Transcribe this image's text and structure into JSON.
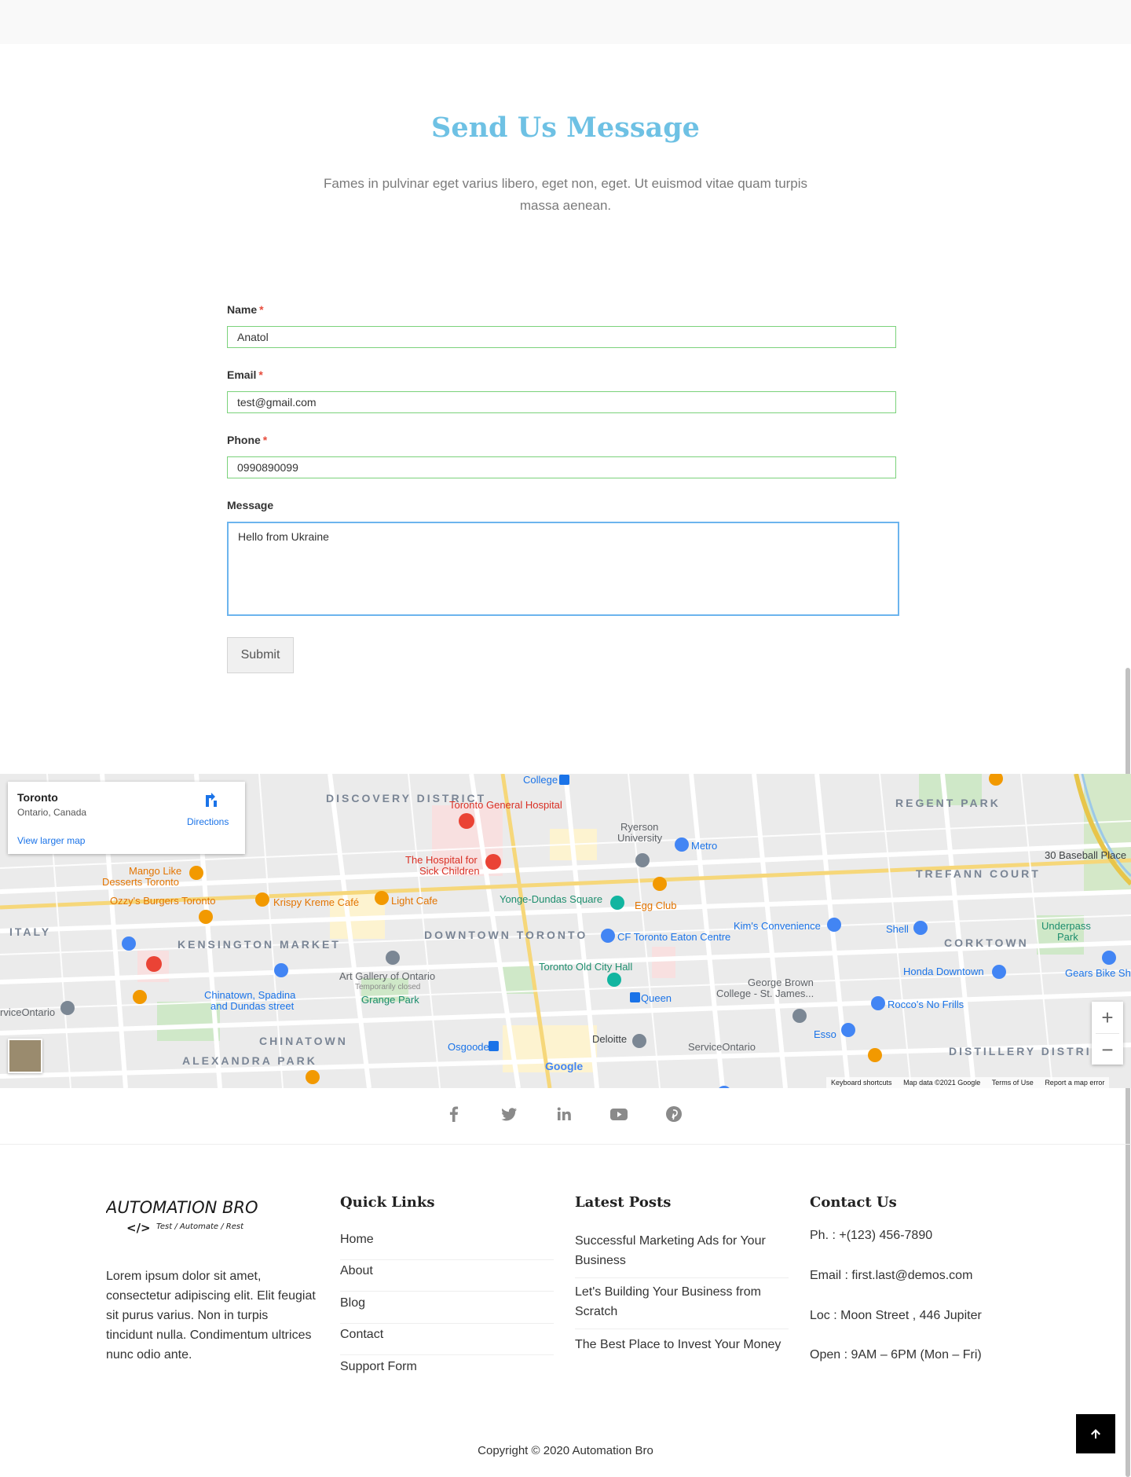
{
  "contact_section": {
    "title": "Send Us Message",
    "description": "Fames in pulvinar eget varius libero, eget non, eget. Ut euismod vitae quam turpis massa aenean."
  },
  "form": {
    "name_label": "Name",
    "email_label": "Email",
    "phone_label": "Phone",
    "message_label": "Message",
    "required_mark": "*",
    "name_value": "Anatol",
    "email_value": "test@gmail.com",
    "phone_value": "0990890099",
    "message_value": "Hello from Ukraine",
    "submit_label": "Submit"
  },
  "map": {
    "place_name": "Toronto",
    "place_sub": "Ontario, Canada",
    "directions_label": "Directions",
    "larger_map_label": "View larger map",
    "zoom_in": "+",
    "zoom_out": "−",
    "google_logo": "Google",
    "attribution": {
      "shortcuts": "Keyboard shortcuts",
      "data": "Map data ©2021 Google",
      "terms": "Terms of Use",
      "report": "Report a map error"
    },
    "labels": {
      "discovery": "DISCOVERY DISTRICT",
      "regent": "REGENT PARK",
      "trefann": "TREFANN COURT",
      "kensington": "KENSINGTON MARKET",
      "downtown": "DOWNTOWN TORONTO",
      "corktown": "CORKTOWN",
      "chinatown": "CHINATOWN",
      "alexandra": "ALEXANDRA PARK",
      "distillery": "DISTILLERY DISTRICT",
      "italy": "ITALY",
      "tgh": "Toronto General Hospital",
      "sickkids1": "The Hospital for",
      "sickkids2": "Sick Children",
      "ryerson1": "Ryerson",
      "ryerson2": "University",
      "metro": "Metro",
      "college": "College",
      "yonge": "Yonge-Dundas Square",
      "eggclub": "Egg Club",
      "eaton": "CF Toronto Eaton Centre",
      "kims": "Kim's Convenience",
      "shell": "Shell",
      "oldcity": "Toronto Old City Hall",
      "queen": "Queen",
      "osgoode": "Osgoode",
      "deloitte": "Deloitte",
      "serviceont": "ServiceOntario",
      "georgebrown1": "George Brown",
      "georgebrown2": "College - St. James...",
      "roccos": "Rocco's No Frills",
      "esso": "Esso",
      "honda": "Honda Downtown",
      "gears": "Gears Bike Sh",
      "underpass1": "Underpass",
      "underpass2": "Park",
      "baseball": "30 Baseball Place",
      "mango1": "Mango Like",
      "mango2": "Desserts Toronto",
      "ozzys": "Ozzy's Burgers Toronto",
      "krispy": "Krispy Kreme Café",
      "lightcafe": "Light Cafe",
      "ago1": "Art Gallery of Ontario",
      "ago2": "Temporarily closed",
      "grange": "Grange Park",
      "chinatown_sp1": "Chinatown, Spadina",
      "chinatown_sp2": "and Dundas street",
      "serviceont_left": "rviceOntario"
    }
  },
  "social": {
    "icons": [
      "facebook-icon",
      "twitter-icon",
      "linkedin-icon",
      "youtube-icon",
      "pinterest-icon"
    ]
  },
  "footer": {
    "logo_text": "AUTOMATION BRO",
    "logo_tagline": "Test / Automate / Rest",
    "logo_symbol": "</>",
    "about": "Lorem ipsum dolor sit amet, consectetur adipiscing elit. Elit feugiat sit purus varius. Non in turpis tincidunt nulla. Condimentum ultrices nunc odio ante.",
    "quick_links_title": "Quick Links",
    "quick_links": [
      "Home",
      "About",
      "Blog",
      "Contact",
      "Support Form"
    ],
    "latest_posts_title": "Latest Posts",
    "latest_posts": [
      "Successful Marketing Ads for Your Business",
      "Let's Building Your Business from Scratch",
      "The Best Place to Invest Your Money"
    ],
    "contact_title": "Contact Us",
    "contact": {
      "phone": "Ph. : +(123) 456-7890",
      "email": "Email : first.last@demos.com",
      "location": "Loc : Moon Street , 446 Jupiter",
      "hours": "Open : 9AM – 6PM (Mon – Fri)"
    },
    "copyright": "Copyright © 2020 Automation Bro"
  },
  "colors": {
    "accent": "#6ec1e4",
    "input_border": "#7bd27b",
    "focus_border": "#6cb4ee",
    "required": "#e74c3c"
  }
}
